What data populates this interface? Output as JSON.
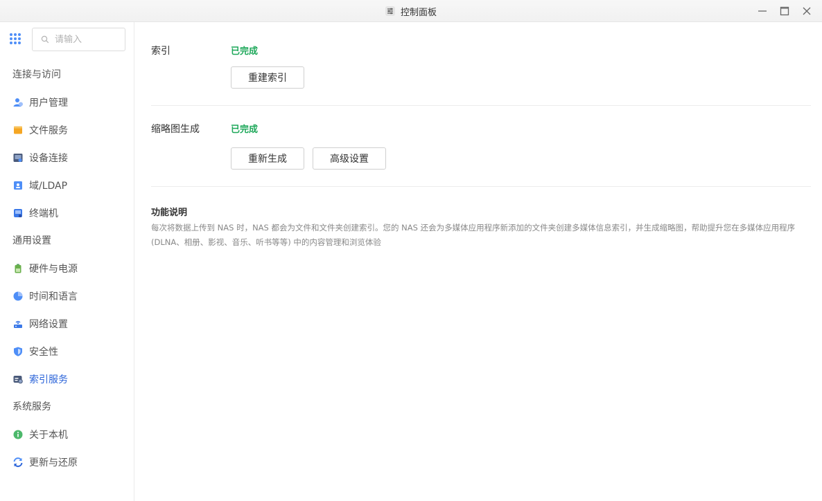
{
  "window": {
    "title": "控制面板",
    "app_icon": "sliders-icon"
  },
  "search": {
    "placeholder": "请输入",
    "value": ""
  },
  "sidebar": {
    "groups": [
      {
        "label": "连接与访问",
        "items": [
          {
            "label": "用户管理",
            "icon": "users-icon"
          },
          {
            "label": "文件服务",
            "icon": "folder-icon"
          },
          {
            "label": "设备连接",
            "icon": "device-icon"
          },
          {
            "label": "域/LDAP",
            "icon": "domain-icon"
          },
          {
            "label": "终端机",
            "icon": "terminal-icon"
          }
        ]
      },
      {
        "label": "通用设置",
        "items": [
          {
            "label": "硬件与电源",
            "icon": "battery-icon"
          },
          {
            "label": "时间和语言",
            "icon": "globe-icon"
          },
          {
            "label": "网络设置",
            "icon": "network-icon"
          },
          {
            "label": "安全性",
            "icon": "shield-icon"
          },
          {
            "label": "索引服务",
            "icon": "index-icon",
            "active": true
          }
        ]
      },
      {
        "label": "系统服务",
        "items": [
          {
            "label": "关于本机",
            "icon": "info-icon"
          },
          {
            "label": "更新与还原",
            "icon": "refresh-icon"
          }
        ]
      }
    ]
  },
  "main": {
    "index": {
      "label": "索引",
      "status": "已完成",
      "rebuild_button": "重建索引"
    },
    "thumbnail": {
      "label": "缩略图生成",
      "status": "已完成",
      "regenerate_button": "重新生成",
      "advanced_button": "高级设置"
    },
    "description": {
      "title": "功能说明",
      "text": "每次将数据上传到 NAS 时，NAS 都会为文件和文件夹创建索引。您的 NAS 还会为多媒体应用程序新添加的文件夹创建多媒体信息索引，并生成缩略图，帮助提升您在多媒体应用程序 (DLNA、相册、影视、音乐、听书等等) 中的内容管理和浏览体验"
    }
  },
  "colors": {
    "status_green": "#1ea85a",
    "active_blue": "#2b64d9",
    "accent_blue": "#4e8ef7"
  }
}
